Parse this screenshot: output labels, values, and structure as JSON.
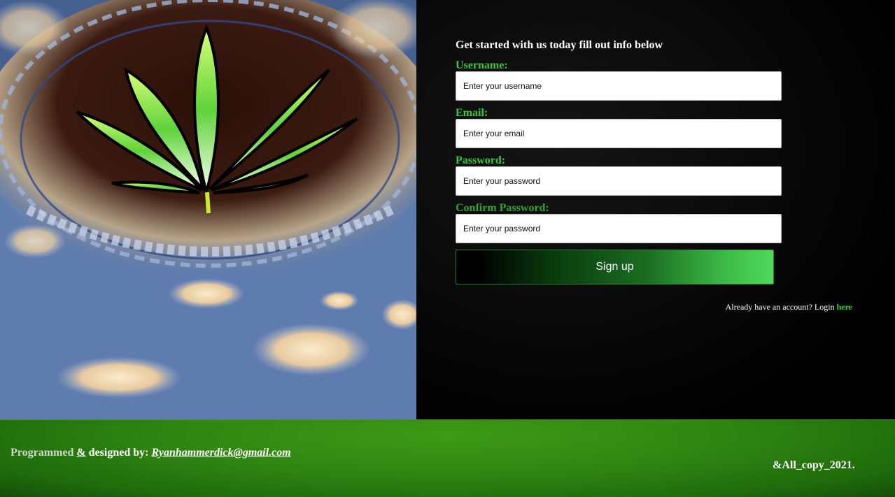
{
  "form": {
    "intro": "Get started with us today fill out info below",
    "fields": [
      {
        "label": "Username:",
        "placeholder": "Enter your username"
      },
      {
        "label": "Email:",
        "placeholder": "Enter your email"
      },
      {
        "label": "Password:",
        "placeholder": "Enter your password"
      },
      {
        "label": "Confirm Password:",
        "placeholder": "Enter your password"
      }
    ],
    "submit_label": "Sign up",
    "login_prompt": "Already have an account? Login",
    "login_link": "here"
  },
  "footer": {
    "credit_prefix": "Programmed",
    "credit_amp": "&",
    "credit_middle": "designed by:",
    "credit_email": "Ryanhammerdick@gmail.com",
    "copyright": "&All_copy_2021."
  },
  "colors": {
    "label_green": "#39c83a",
    "footer_green": "#2f8512",
    "link_green": "#3fd04a"
  },
  "hero": {
    "image_subject": "cannabis-leaf-psychedelic-art-over-sky"
  }
}
